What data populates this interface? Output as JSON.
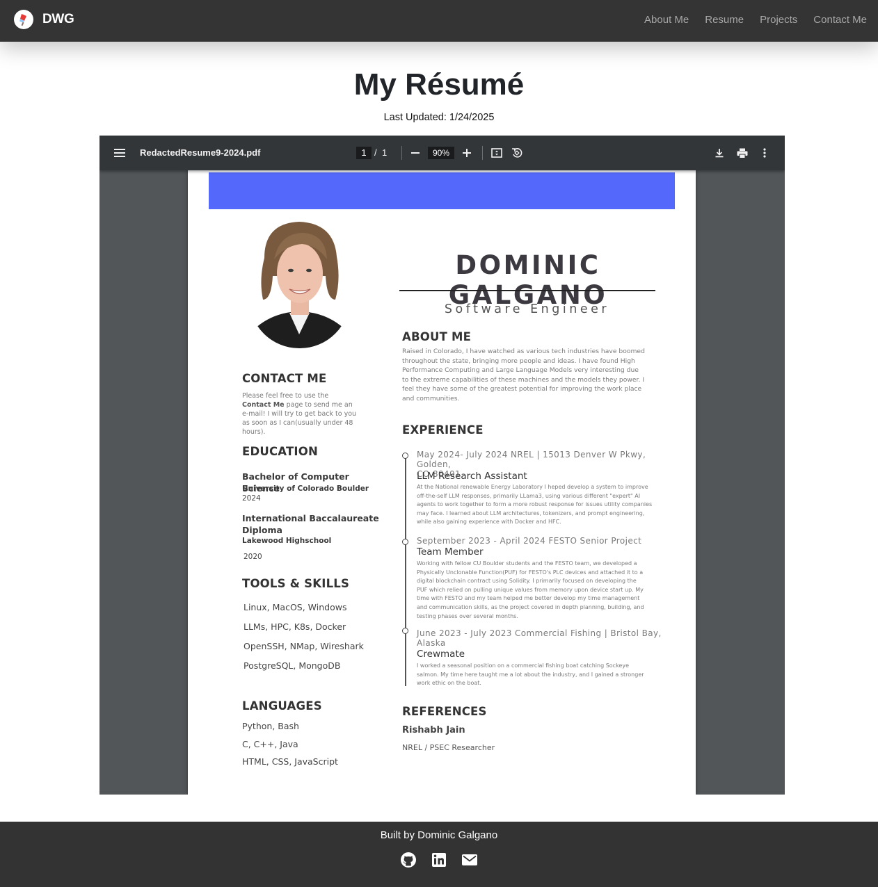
{
  "navbar": {
    "brand": "DWG",
    "links": [
      "About Me",
      "Resume",
      "Projects",
      "Contact Me"
    ]
  },
  "header": {
    "title": "My Résumé",
    "last_updated": "Last Updated: 1/24/2025"
  },
  "pdf_viewer": {
    "filename": "RedactedResume9-2024.pdf",
    "current_page": "1",
    "page_separator": "/",
    "total_pages": "1",
    "zoom": "90%",
    "icons": [
      "menu-icon",
      "zoom-out-icon",
      "zoom-in-icon",
      "fit-page-icon",
      "rotate-icon",
      "download-icon",
      "print-icon",
      "more-options-icon"
    ]
  },
  "resume": {
    "banner_color": "#5469fb",
    "name": "DOMINIC GALGANO",
    "role": "Software Engineer",
    "about": {
      "heading": "ABOUT ME",
      "lines": [
        "Raised in Colorado, I have watched as various tech industries have boomed",
        "throughout the state, bringing more people and ideas. I have found High",
        "Performance Computing and Large Language Models very interesting due",
        "to the extreme capabilities of these machines and the models they power. I",
        "feel they have some of the greatest potential for improving the work place",
        "and communities."
      ]
    },
    "contact": {
      "heading": "CONTACT ME",
      "line1": "Please feel free to use the",
      "bold": "Contact Me",
      "line2_rest": " page to send me an",
      "line3": "e-mail! I will try to get back to you",
      "line4": "as soon as I can(usually under 48",
      "line5": "hours)."
    },
    "education": {
      "heading": "EDUCATION",
      "items": [
        {
          "degree": "Bachelor of Computer Science",
          "institution": "University of Colorado Boulder",
          "year": "2024"
        },
        {
          "degree": "International Baccalaureate Diploma",
          "institution": "Lakewood Highschool",
          "year": "2020"
        }
      ]
    },
    "skills": {
      "heading": "TOOLS & SKILLS",
      "items": [
        "Linux, MacOS, Windows",
        "LLMs, HPC, K8s, Docker",
        "OpenSSH, NMap, Wireshark",
        "PostgreSQL, MongoDB"
      ]
    },
    "languages": {
      "heading": "LANGUAGES",
      "items": [
        "Python, Bash",
        "C, C++, Java",
        "HTML, CSS, JavaScript"
      ]
    },
    "experience": {
      "heading": "EXPERIENCE",
      "items": [
        {
          "date_lines": [
            "May 2024- July 2024 NREL | 15013 Denver W Pkwy, Golden,",
            "CO 80401"
          ],
          "title": "LLM Research Assistant",
          "desc_lines": [
            "At the National renewable Energy Laboratory I heped develop a system to improve",
            "off-the-self LLM responses, primarily LLama3, using various different \"expert\" AI",
            "agents to work together to form a more robust response for issues utility companies",
            "may face. I learned about LLM architectures, tokenizers, and prompt engineering,",
            "while also gaining experience with Docker and HFC."
          ]
        },
        {
          "date_lines": [
            "September 2023 - April 2024 FESTO Senior Project"
          ],
          "title": "Team Member",
          "desc_lines": [
            "Working with fellow CU Boulder students and the FESTO team, we developed a",
            "Physically Unclonable Function(PUF) for FESTO's PLC devices and attached it to a",
            "digital blockchain contract using Solidity. I primarily focused on developing the",
            "PUF which relied on pulling unique values from memory upon device start up. My",
            "time with FESTO and my team helped me better develop my time management",
            "and communication skills, as the project covered in depth planning, building, and",
            "testing phases over several months."
          ]
        },
        {
          "date_lines": [
            "June 2023 - July 2023 Commercial Fishing | Bristol Bay,",
            "Alaska"
          ],
          "title": "Crewmate",
          "desc_lines": [
            "I worked a seasonal position on a commercial fishing boat catching Sockeye",
            "salmon. My time here taught me a lot about the industry, and I gained a stronger",
            "work ethic on the boat."
          ]
        }
      ]
    },
    "references": {
      "heading": "REFERENCES",
      "name": "Rishabh Jain",
      "role": "NREL / PSEC Researcher"
    }
  },
  "footer": {
    "text": "Built by Dominic Galgano",
    "icons": [
      "github-icon",
      "linkedin-icon",
      "email-icon"
    ]
  }
}
